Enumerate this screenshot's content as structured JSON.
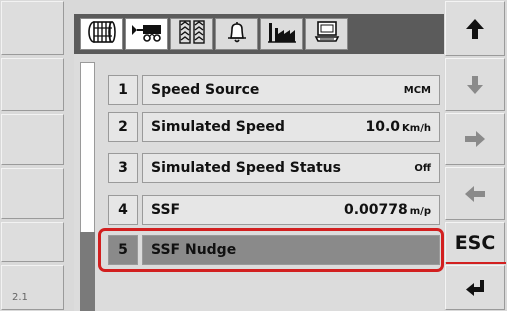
{
  "left_softkeys": {
    "corner_label": "2.1"
  },
  "tabs": [
    {
      "icon": "drum-icon",
      "active": true
    },
    {
      "icon": "seeder-icon",
      "active": true
    },
    {
      "icon": "tire-tracks-icon",
      "active": false
    },
    {
      "icon": "bell-icon",
      "active": false
    },
    {
      "icon": "factory-icon",
      "active": false
    },
    {
      "icon": "computer-icon",
      "active": false
    }
  ],
  "rows": [
    {
      "num": "1",
      "label": "Speed Source",
      "value": "MCM",
      "unit": ""
    },
    {
      "num": "2",
      "label": "Simulated Speed",
      "value": "10.0",
      "unit": "Km/h"
    },
    {
      "num": "3",
      "label": "Simulated Speed Status",
      "value": "Off",
      "unit": ""
    },
    {
      "num": "4",
      "label": "SSF",
      "value": "0.00778",
      "unit": "m/p"
    },
    {
      "num": "5",
      "label": "SSF Nudge",
      "value": "",
      "unit": ""
    }
  ],
  "selected_row": "5",
  "right_softkeys": {
    "up": "arrow-up-icon",
    "down": "arrow-down-icon",
    "right": "arrow-right-icon",
    "left": "arrow-left-icon",
    "esc_label": "ESC",
    "enter": "enter-icon"
  },
  "colors": {
    "highlight": "#d21f1f",
    "selected_row": "#8a8a8a",
    "tab_strip": "#5b5b5b"
  }
}
